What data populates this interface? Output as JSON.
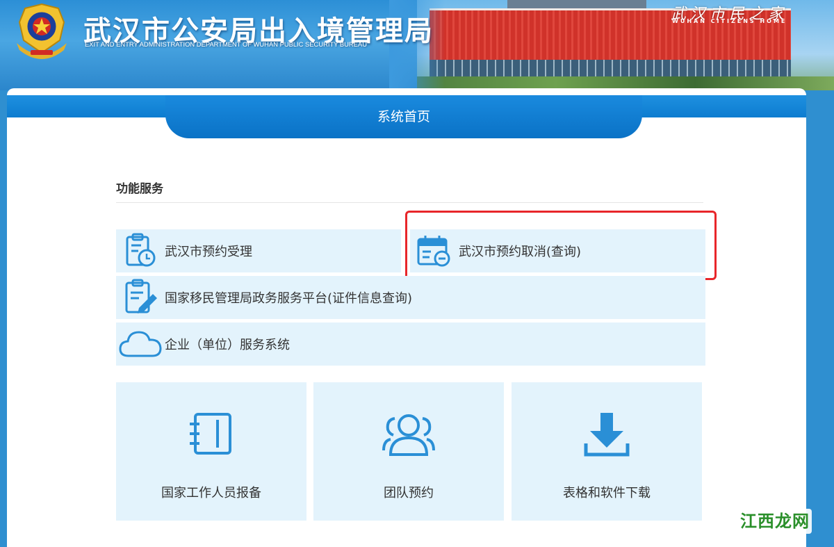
{
  "header": {
    "title": "武汉市公安局出入境管理局",
    "subtitle": "EXIT AND ENTRY ADMINISTRATION DEPARTMENT OF WUHAN PUBLIC SECURITY BUREAU",
    "slogan": "武汉市民之家",
    "slogan_en": "WUHAN  CITIZENS  HOME"
  },
  "nav": {
    "home_label": "系统首页"
  },
  "section": {
    "title": "功能服务"
  },
  "services": [
    {
      "label": "武汉市预约受理",
      "icon": "clipboard-clock-icon"
    },
    {
      "label": "武汉市预约取消(查询)",
      "icon": "calendar-minus-icon"
    },
    {
      "label": "国家移民管理局政务服务平台(证件信息查询)",
      "icon": "clipboard-edit-icon"
    },
    {
      "label": "企业（单位）服务系统",
      "icon": "cloud-icon"
    }
  ],
  "tiles": [
    {
      "label": "国家工作人员报备",
      "icon": "notebook-icon"
    },
    {
      "label": "团队预约",
      "icon": "group-icon"
    },
    {
      "label": "表格和软件下载",
      "icon": "download-icon"
    }
  ],
  "watermark": "江西龙网",
  "colors": {
    "primary": "#0d7cd0",
    "icon": "#2a8fd6",
    "tile_bg": "#e3f3fc",
    "highlight": "#e8262a"
  }
}
